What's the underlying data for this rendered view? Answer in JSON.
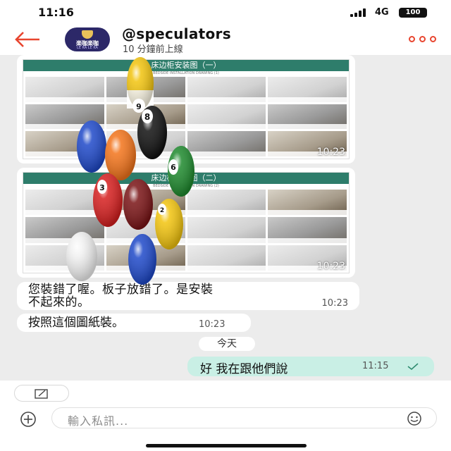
{
  "status_bar": {
    "time": "11:16",
    "network": "4G",
    "battery": "100"
  },
  "header": {
    "avatar_text": "楽咖楽咖",
    "avatar_subtext": "LE KA LE KA",
    "contact_name": "@speculators",
    "contact_status": "10 分鐘前上線"
  },
  "messages": {
    "image1": {
      "title": "床边柜安装图（一）",
      "subtitle": "BEDSIDE INSTALLATION DRAWING (1)",
      "time": "10:23"
    },
    "image2": {
      "title": "床边柜安装图（二）",
      "subtitle": "BEDSIDE INSTALLATION DRAWING (2)",
      "time": "10:23"
    },
    "text1": {
      "line1": "您裝錯了喔。板子放錯了。是安裝",
      "line2": "不起來的。",
      "time": "10:23"
    },
    "text2": {
      "text": "按照這個圖紙裝。",
      "time": "10:23"
    },
    "date_divider": "今天",
    "outgoing": {
      "text": "好 我在跟他們說",
      "time": "11:15"
    }
  },
  "compose": {
    "placeholder": "輸入私訊..."
  },
  "overlay": {
    "ball_numbers": [
      "9",
      "8",
      "3",
      "6",
      "2"
    ],
    "colors": {
      "yellow": "#f2c40f",
      "blue": "#1f49c9",
      "orange": "#f3741b",
      "red": "#d61f1f",
      "maroon": "#7a1416",
      "green": "#1f8a2e",
      "black": "#111111",
      "white": "#f2f2f2"
    }
  },
  "colors": {
    "accent": "#e8452f",
    "outgoing_bubble": "#c9efe5",
    "doc_header": "#2e7d6b"
  },
  "icons": [
    "back-arrow-icon",
    "more-icon",
    "read-check-icon",
    "edit-icon",
    "plus-icon",
    "emoji-icon"
  ]
}
